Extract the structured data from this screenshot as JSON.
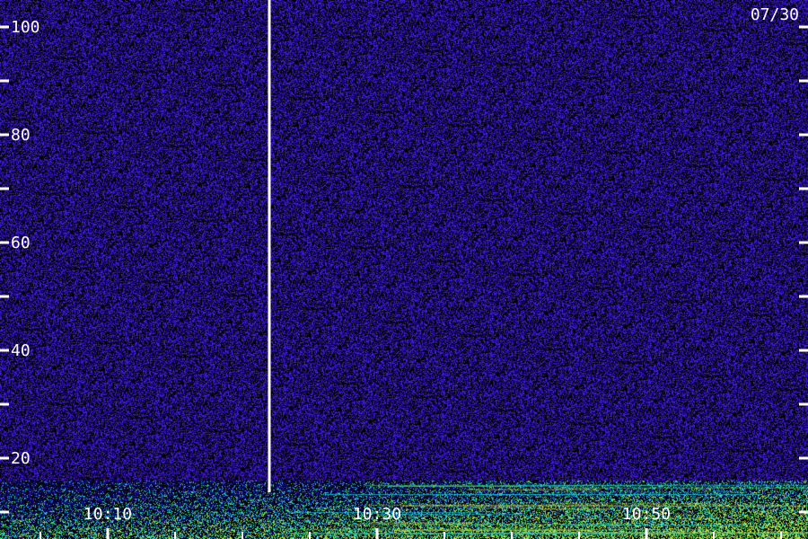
{
  "chart_data": {
    "type": "heatmap",
    "date_label": "07/30",
    "y_ticks": [
      {
        "value": 100,
        "label": "100"
      },
      {
        "value": 80,
        "label": "80"
      },
      {
        "value": 60,
        "label": "60"
      },
      {
        "value": 40,
        "label": "40"
      },
      {
        "value": 20,
        "label": "20"
      }
    ],
    "y_minor_ticks": [
      10,
      30,
      50,
      70,
      90
    ],
    "ylim": [
      5,
      105
    ],
    "x_ticks": [
      {
        "time": "10:10",
        "label": "10:10"
      },
      {
        "time": "10:30",
        "label": "10:30"
      },
      {
        "time": "10:50",
        "label": "10:50"
      }
    ],
    "xlim": [
      "10:02",
      "11:02"
    ],
    "marker_time": "10:22",
    "colors": {
      "background": "#000000",
      "noise_low": "#2a0a8a",
      "noise_high": "#4a20d0",
      "band_cyan": "#18c8e8",
      "band_green": "#50e050",
      "band_yellow": "#e8e840",
      "axis": "#ffffff"
    }
  }
}
